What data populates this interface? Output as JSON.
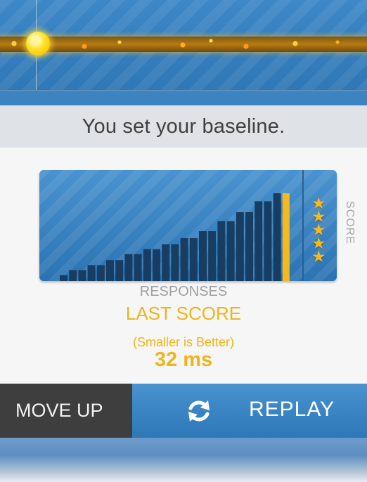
{
  "banner": {
    "text": "You set your baseline."
  },
  "chart": {
    "side_label": "SCORE",
    "stars": 5,
    "bars_heights": [
      0.06,
      0.11,
      0.11,
      0.16,
      0.16,
      0.21,
      0.21,
      0.27,
      0.27,
      0.32,
      0.32,
      0.37,
      0.37,
      0.43,
      0.43,
      0.5,
      0.5,
      0.6,
      0.6,
      0.69,
      0.69,
      0.8,
      0.8,
      0.88
    ],
    "highlight_height": 0.88,
    "bar_color": "#173d63",
    "highlight_color": "#f6b81c"
  },
  "responses_label": "RESPONSES",
  "last_score_label": "LAST SCORE",
  "smaller_label": "(Smaller is Better)",
  "score_value": "32 ms",
  "buttons": {
    "move_up": "MOVE UP",
    "replay": "REPLAY"
  }
}
